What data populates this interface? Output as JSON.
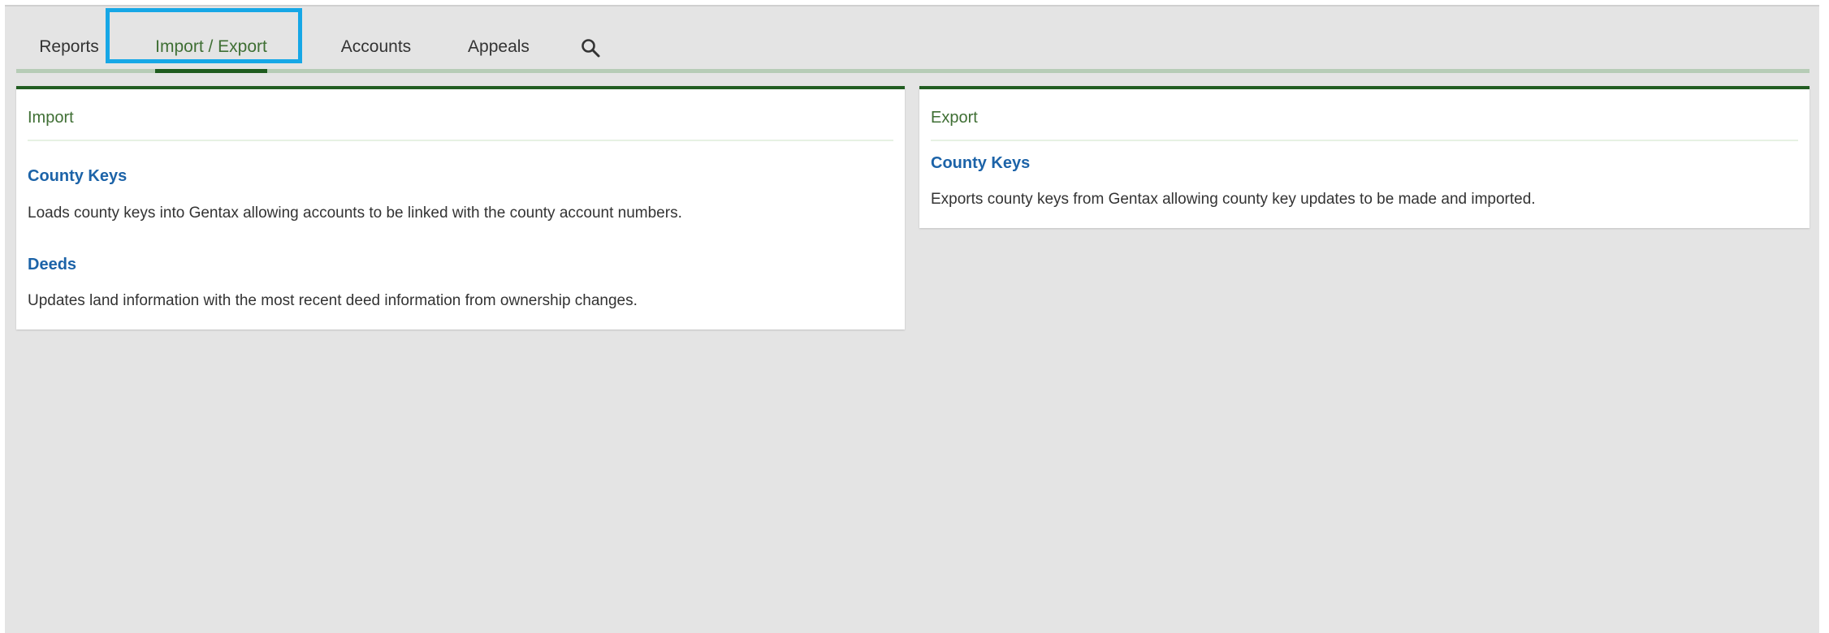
{
  "tabs": [
    {
      "label": "Reports"
    },
    {
      "label": "Import / Export"
    },
    {
      "label": "Accounts"
    },
    {
      "label": "Appeals"
    }
  ],
  "search": {
    "icon": "search-icon"
  },
  "colors": {
    "accent_green": "#225d22",
    "link_blue": "#1c63a8",
    "highlight_blue": "#16a7e6"
  },
  "import_panel": {
    "title": "Import",
    "items": [
      {
        "link": "County Keys",
        "description": "Loads county keys into Gentax allowing accounts to be linked with the county account numbers."
      },
      {
        "link": "Deeds",
        "description": "Updates land information with the most recent deed information from ownership changes."
      }
    ]
  },
  "export_panel": {
    "title": "Export",
    "items": [
      {
        "link": "County Keys",
        "description": "Exports county keys from Gentax allowing county key updates to be made and imported."
      }
    ]
  }
}
